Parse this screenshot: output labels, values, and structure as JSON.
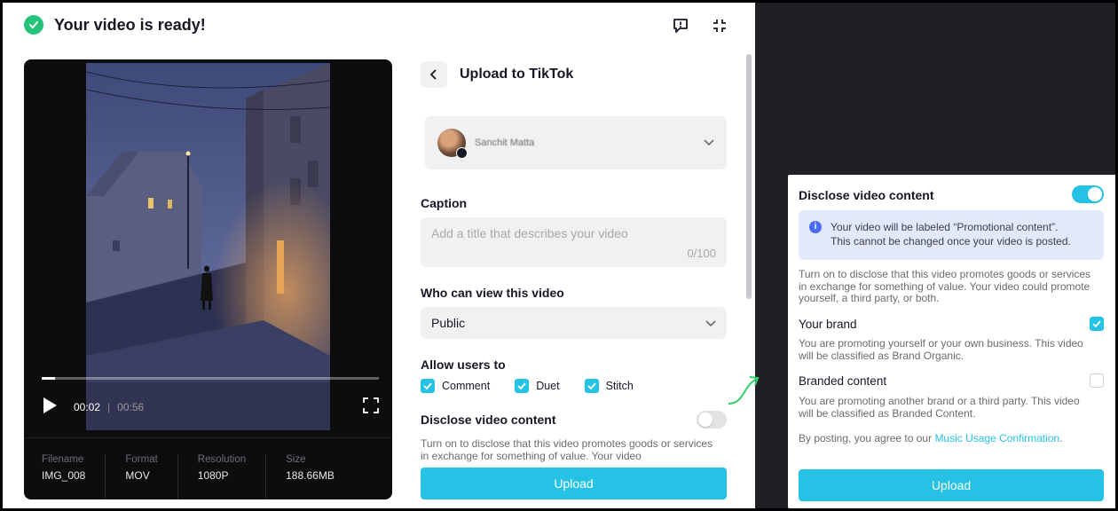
{
  "header": {
    "title": "Your video is ready!"
  },
  "player": {
    "current_time": "00:02",
    "total_time": "00:56",
    "progress": 0.04,
    "meta": [
      {
        "label": "Filename",
        "value": "IMG_008"
      },
      {
        "label": "Format",
        "value": "MOV"
      },
      {
        "label": "Resolution",
        "value": "1080P"
      },
      {
        "label": "Size",
        "value": "188.66MB"
      }
    ]
  },
  "upload": {
    "title": "Upload to TikTok",
    "account_name": "Sanchit Matta",
    "caption_label": "Caption",
    "caption_placeholder": "Add a title that describes your video",
    "caption_count": "0/100",
    "visibility_label": "Who can view this video",
    "visibility_value": "Public",
    "allow_label": "Allow users to",
    "allow": [
      {
        "label": "Comment",
        "checked": true
      },
      {
        "label": "Duet",
        "checked": true
      },
      {
        "label": "Stitch",
        "checked": true
      }
    ],
    "disclose_label": "Disclose video content",
    "disclose_desc": "Turn on to disclose that this video promotes goods or services in exchange for something of value. Your video",
    "upload_label": "Upload"
  },
  "disclose_panel": {
    "title": "Disclose video content",
    "info_line1": "Your video will be labeled “Promotional content”.",
    "info_line2": "This cannot be changed once your video is posted.",
    "desc": "Turn on to disclose that this video promotes goods or services in exchange for something of value. Your video could promote yourself, a third party, or both.",
    "your_brand_label": "Your brand",
    "your_brand_desc": "You are promoting yourself or your own business. This video will be classified as Brand Organic.",
    "branded_label": "Branded content",
    "branded_desc": "You are promoting another brand or a third party. This video will be classified as Branded Content.",
    "agree_text": "By posting, you agree to our ",
    "agree_link": "Music Usage Confirmation",
    "agree_end": ".",
    "upload_label": "Upload"
  },
  "colors": {
    "accent": "#25c2e6",
    "success": "#25c37a",
    "dark_panel": "#1f2024"
  }
}
